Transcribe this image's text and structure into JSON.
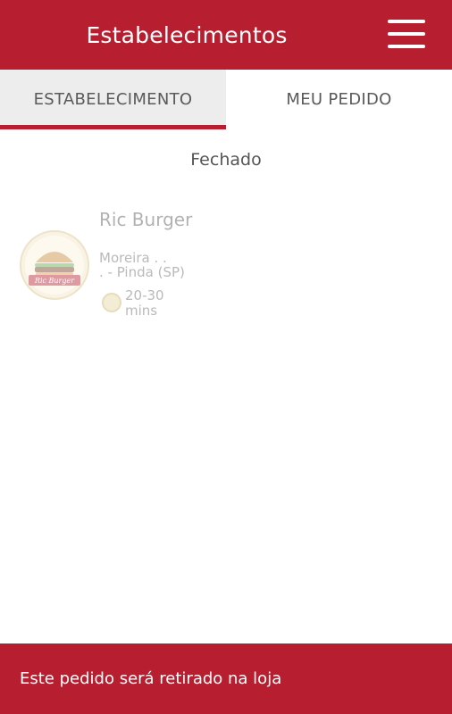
{
  "header": {
    "title": "Estabelecimentos",
    "menu_icon": "hamburger-menu-icon"
  },
  "tabs": [
    {
      "label": "ESTABELECIMENTO",
      "active": true
    },
    {
      "label": "MEU PEDIDO",
      "active": false
    }
  ],
  "status": "Fechado",
  "store": {
    "name": "Ric Burger",
    "address_line1": "Moreira . .",
    "address_line2": ". - Pinda (SP)",
    "time_line1": "20-30",
    "time_line2": "mins",
    "logo_text": "Ric Burger",
    "time_icon": "clock-icon"
  },
  "footer": {
    "text": "Este pedido será retirado na loja"
  },
  "colors": {
    "primary": "#b71f30",
    "tab_active_bg": "#ededed",
    "text_gray": "#555555"
  }
}
